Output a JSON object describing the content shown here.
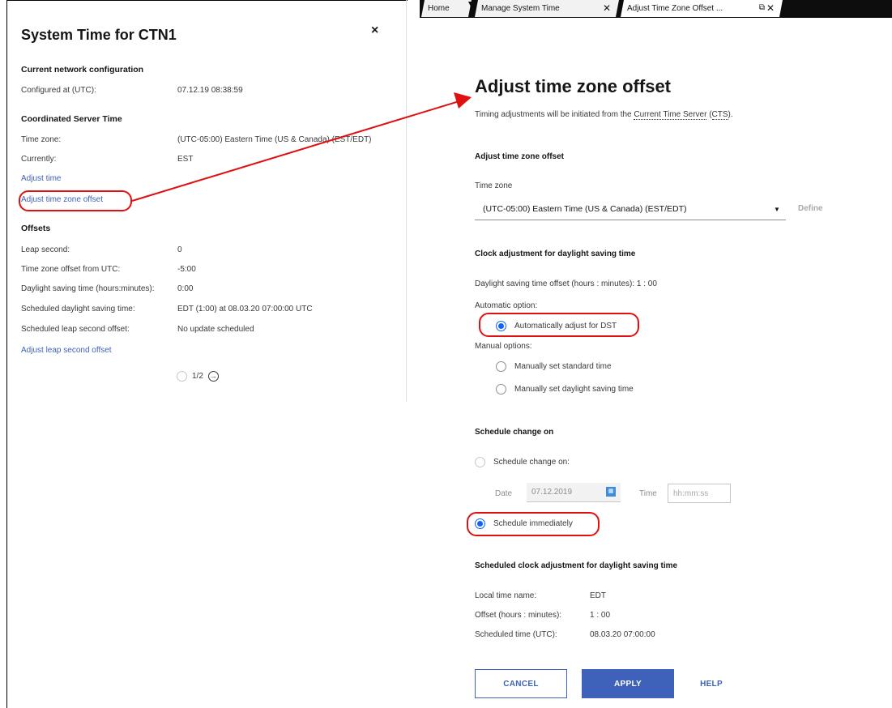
{
  "left_panel": {
    "title": "System Time for CTN1",
    "close_glyph": "×",
    "sections": {
      "network": "Current network configuration",
      "cst": "Coordinated Server Time",
      "offsets": "Offsets"
    },
    "configured_label": "Configured at (UTC):",
    "configured_value": "07.12.19 08:38:59",
    "timezone_label": "Time zone:",
    "timezone_value": "(UTC-05:00) Eastern Time (US & Canada) (EST/EDT)",
    "currently_label": "Currently:",
    "currently_value": "EST",
    "adjust_time_link": "Adjust time",
    "adjust_tz_link": "Adjust time zone offset",
    "leap_label": "Leap second:",
    "leap_value": "0",
    "tz_offset_label": "Time zone offset from UTC:",
    "tz_offset_value": "-5:00",
    "dst_label": "Daylight saving time (hours:minutes):",
    "dst_value": "0:00",
    "sched_dst_label": "Scheduled daylight saving time:",
    "sched_dst_value": "EDT (1:00) at 08.03.20 07:00:00 UTC",
    "sched_leap_label": "Scheduled leap second offset:",
    "sched_leap_value": "No update scheduled",
    "adjust_leap_link": "Adjust leap second offset",
    "pager": "1/2"
  },
  "tabs": [
    {
      "label": "Home"
    },
    {
      "label": "Manage System Time"
    },
    {
      "label": "Adjust Time Zone Offset ..."
    }
  ],
  "right_panel": {
    "title": "Adjust time zone offset",
    "subtitle_prefix": "Timing adjustments will be initiated from the ",
    "subtitle_link": "Current Time Server",
    "subtitle_abbr": "CTS",
    "section_offset": "Adjust time zone offset",
    "timezone_label": "Time zone",
    "timezone_value": "(UTC-05:00) Eastern Time (US & Canada) (EST/EDT)",
    "define_label": "Define",
    "section_clock": "Clock adjustment for daylight saving time",
    "dst_offset_text": "Daylight saving time offset (hours : minutes): 1 : 00",
    "automatic_label": "Automatic option:",
    "auto_dst": "Automatically adjust for DST",
    "manual_label": "Manual options:",
    "manual_standard": "Manually set standard time",
    "manual_dst": "Manually set daylight saving time",
    "section_schedule": "Schedule change on",
    "schedule_on": "Schedule change on:",
    "date_label": "Date",
    "date_value": "07.12.2019",
    "time_label": "Time",
    "time_placeholder": "hh:mm:ss",
    "schedule_now": "Schedule immediately",
    "section_scheduled": "Scheduled clock adjustment for daylight saving time",
    "local_name_label": "Local time name:",
    "local_name_value": "EDT",
    "offset_label": "Offset (hours : minutes):",
    "offset_value": "1 : 00",
    "sched_time_label": "Scheduled time (UTC):",
    "sched_time_value": "08.03.20 07:00:00",
    "cancel": "CANCEL",
    "apply": "APPLY",
    "help": "HELP"
  },
  "colors": {
    "accent": "#3e62b9",
    "annotation": "#e01010",
    "radio_selected": "#0f62fe"
  }
}
